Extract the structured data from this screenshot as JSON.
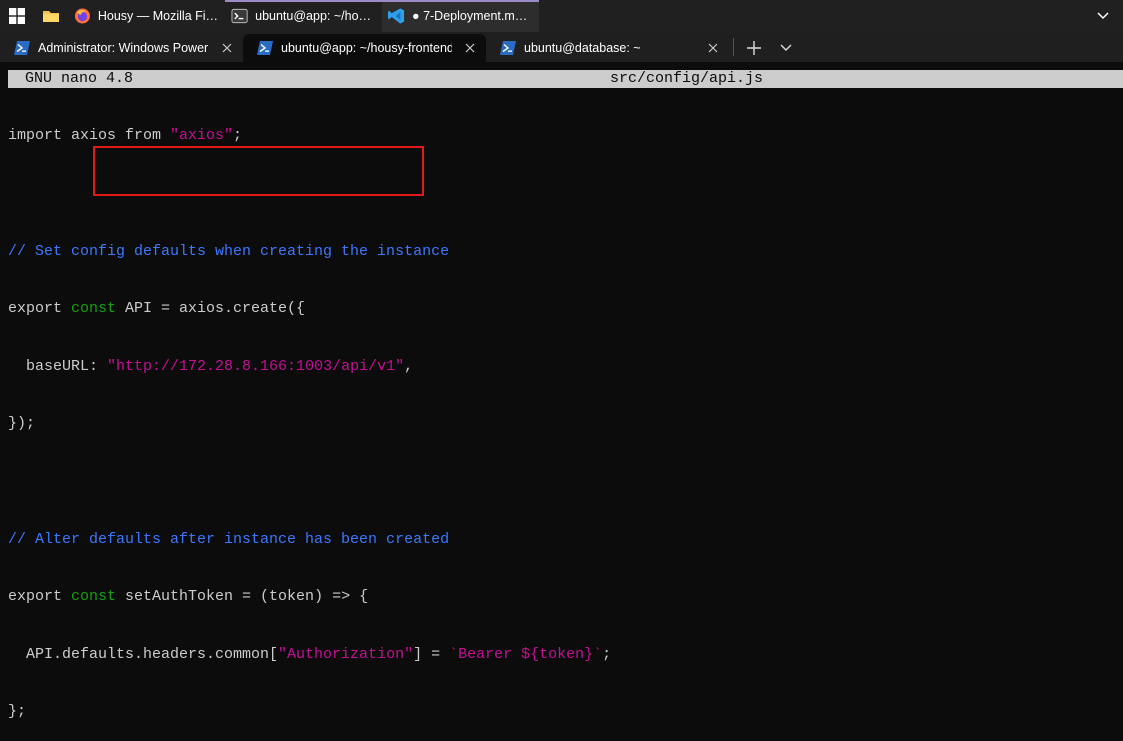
{
  "taskbar": {
    "apps": [
      {
        "label": "Housy — Mozilla Fire...",
        "icon": "firefox-icon",
        "active": false
      },
      {
        "label": "ubuntu@app: ~/hous...",
        "icon": "terminal-icon",
        "active": false
      },
      {
        "label": "● 7-Deployment.md -...",
        "icon": "vscode-icon",
        "active": true
      }
    ]
  },
  "terminal": {
    "tabs": [
      {
        "label": "Administrator: Windows PowerS",
        "active": false
      },
      {
        "label": "ubuntu@app: ~/housy-frontend",
        "active": true
      },
      {
        "label": "ubuntu@database: ~",
        "active": false
      }
    ]
  },
  "nano": {
    "version": "GNU nano 4.8",
    "filename": "src/config/api.js"
  },
  "code": {
    "l1_import": "import axios from ",
    "l1_str": "\"axios\"",
    "l1_end": ";",
    "l3_comment": "// Set config defaults when creating the instance",
    "l4_export": "export ",
    "l4_const": "const",
    "l4_rest": " API = axios.create({",
    "l5_key": "  baseURL: ",
    "l5_str": "\"http://172.28.8.166:1003/api/v1\"",
    "l5_end": ",",
    "l6": "});",
    "l8_comment": "// Alter defaults after instance has been created",
    "l9_export": "export ",
    "l9_const": "const",
    "l9_rest": " setAuthToken = (token) => {",
    "l10_a": "  API.defaults.headers.common[",
    "l10_str": "\"Authorization\"",
    "l10_b": "] = ",
    "l10_tpl": "`Bearer ${token}`",
    "l10_end": ";",
    "l11": "};"
  },
  "colors": {
    "keyword_type": "#13a10e",
    "string": "#c50f94",
    "comment": "#3b78ff",
    "highlight": "#e11b1b"
  }
}
